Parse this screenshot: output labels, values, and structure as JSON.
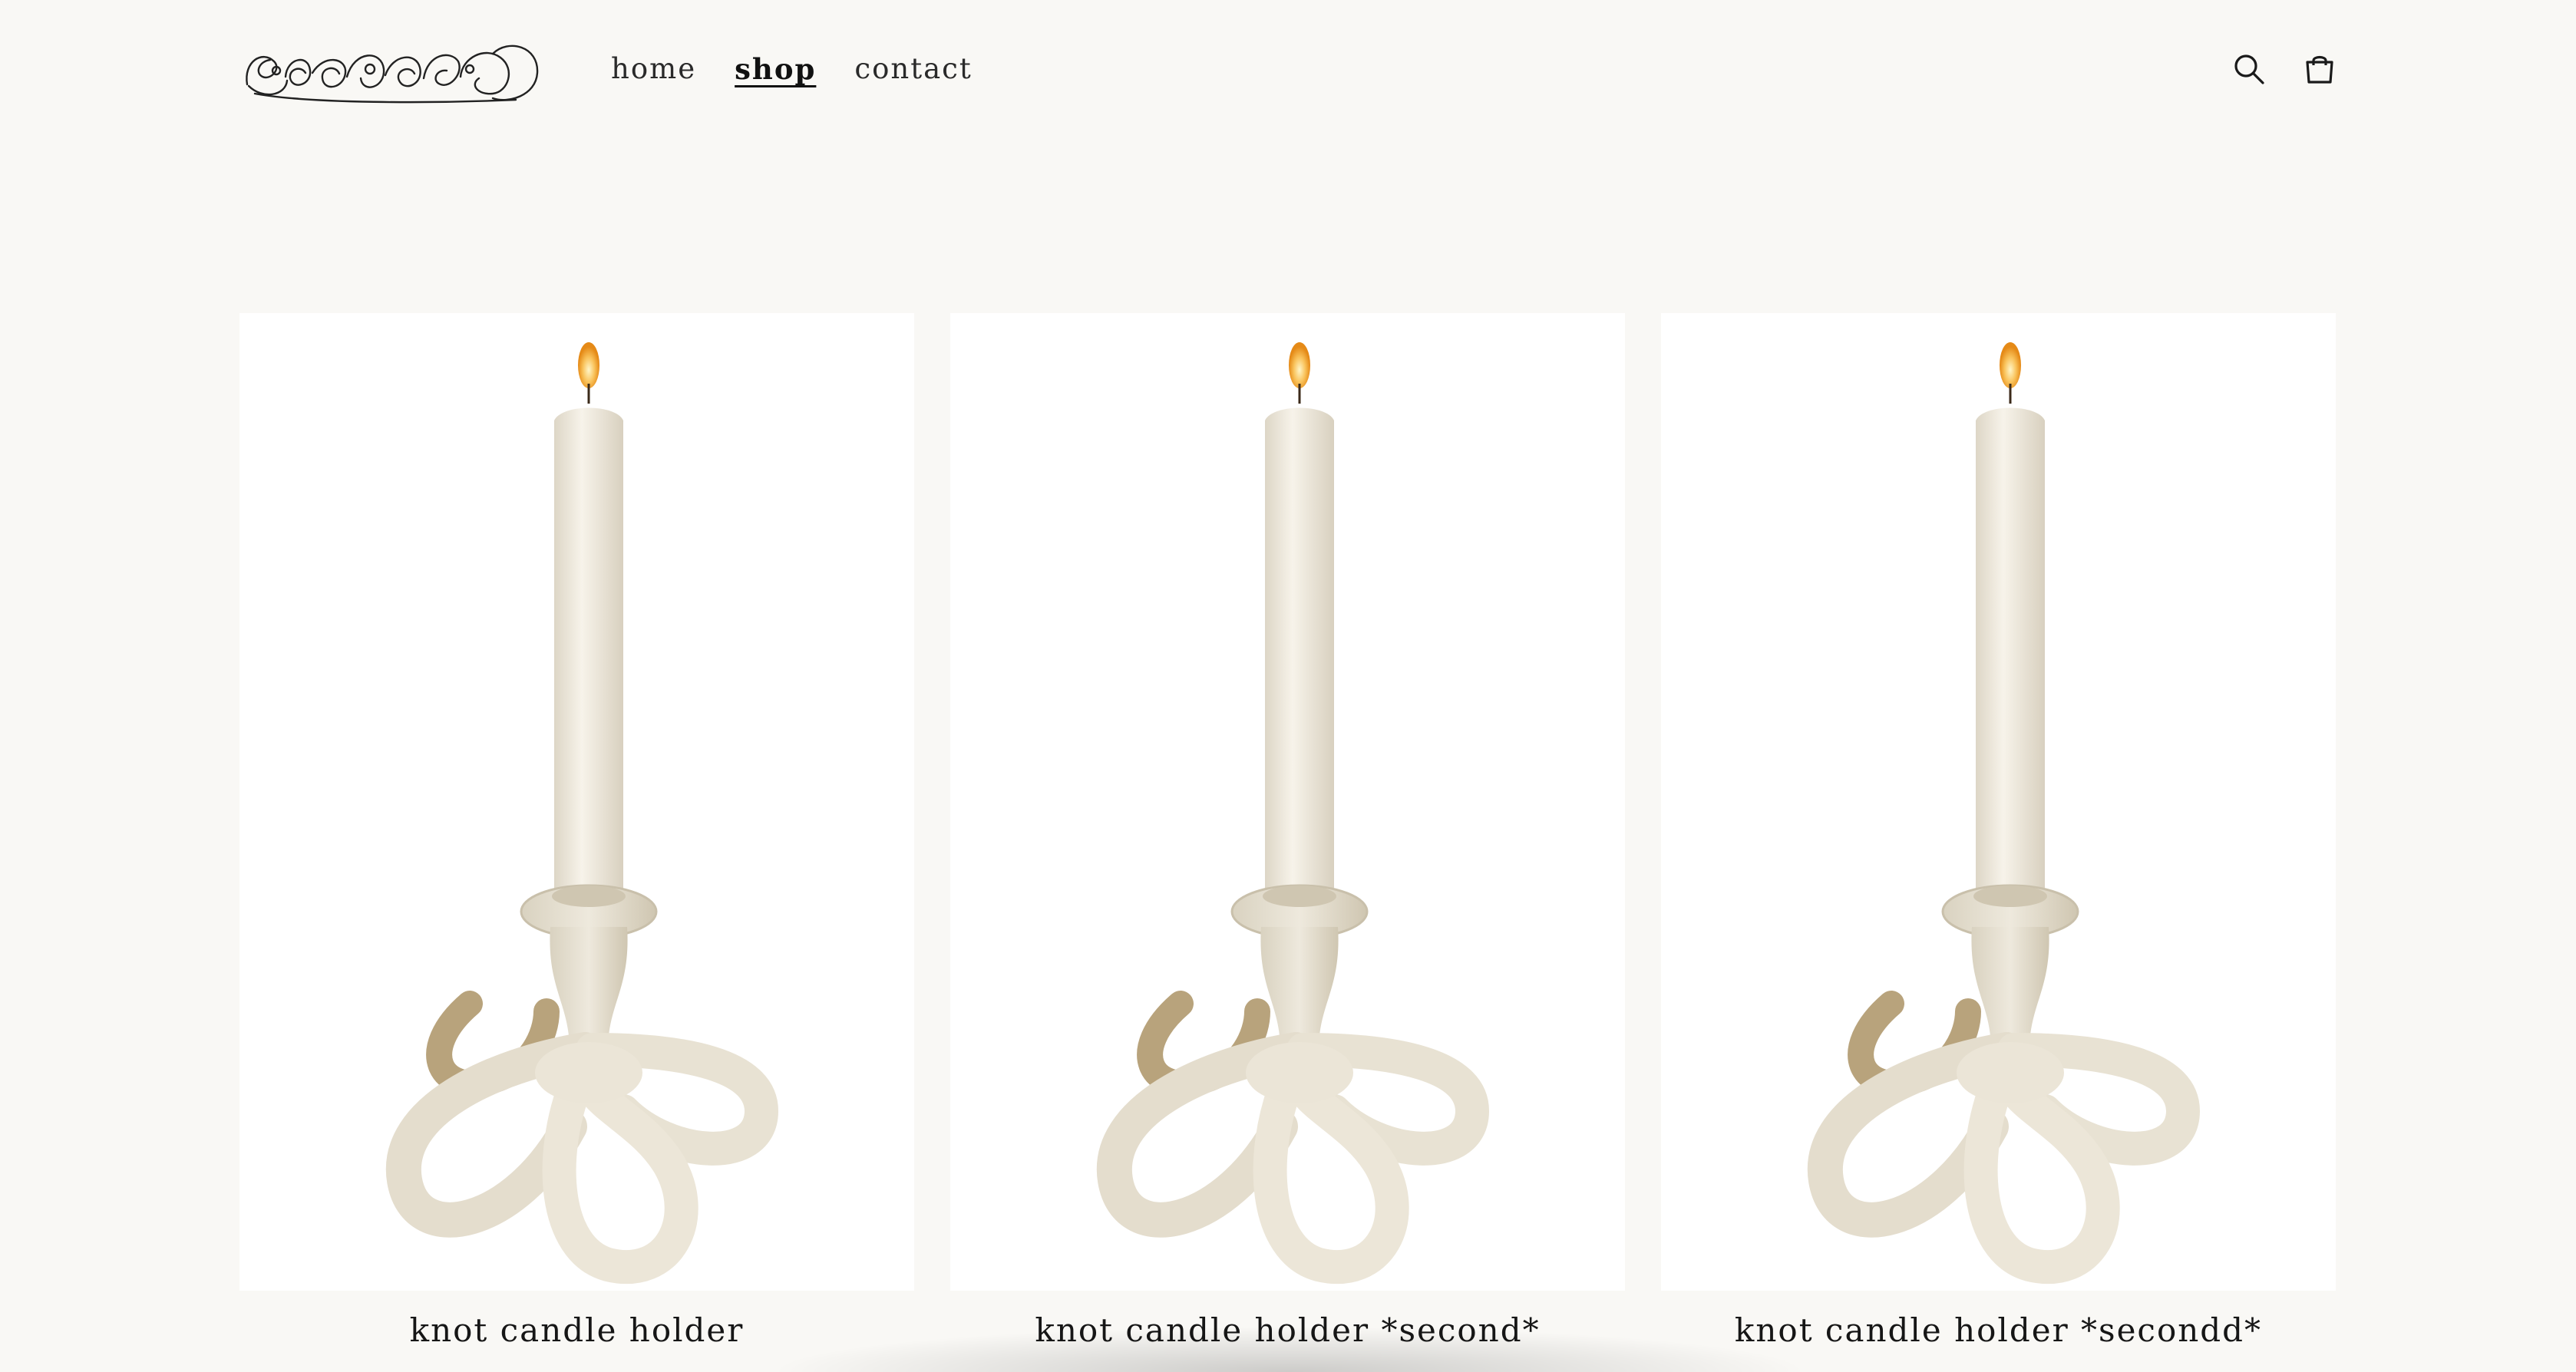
{
  "header": {
    "logo_alt": "logo",
    "nav": [
      {
        "label": "home",
        "active": false
      },
      {
        "label": "shop",
        "active": true
      },
      {
        "label": "contact",
        "active": false
      }
    ],
    "icons": {
      "search": "search-icon",
      "cart": "cart-icon"
    }
  },
  "products": [
    {
      "title": "knot candle holder",
      "image": "white knotted ceramic candle holder with lit candle"
    },
    {
      "title": "knot candle holder *second*",
      "image": "white knotted ceramic candle holder with lit candle"
    },
    {
      "title": "knot candle holder *secondd*",
      "image": "white knotted ceramic candle holder with lit candle"
    }
  ],
  "colors": {
    "page_bg": "#f9f8f5",
    "card_bg": "#ffffff",
    "text": "#1a1a1a",
    "ceramic": "#e9e3d6",
    "candle": "#f3efe4",
    "flame": "#f6a623"
  }
}
